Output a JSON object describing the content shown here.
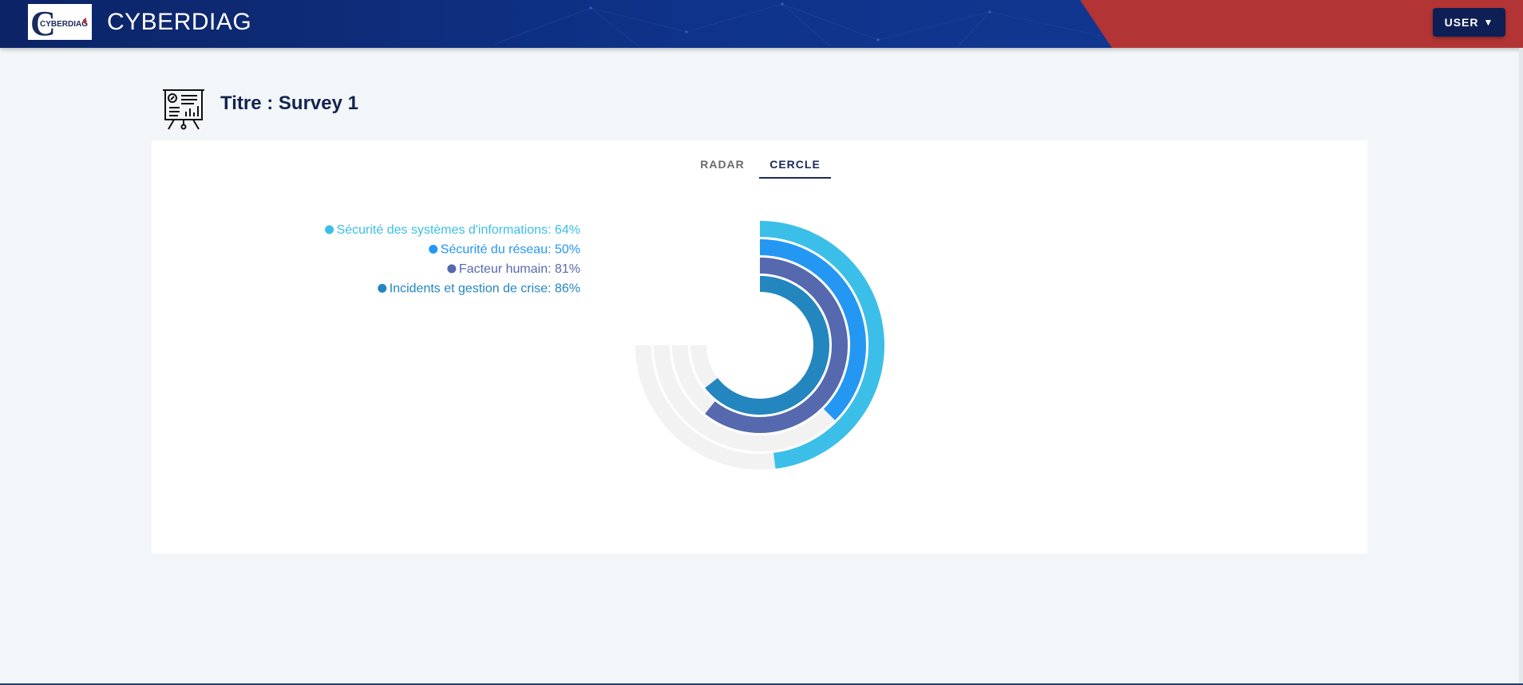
{
  "header": {
    "logo_text": "CYBERDIAG",
    "app_title": "CYBERDIAG",
    "user_button_label": "USER",
    "user_button_caret": "▼"
  },
  "page": {
    "title": "Titre : Survey 1"
  },
  "tabs": [
    {
      "label": "RADAR",
      "active": false
    },
    {
      "label": "CERCLE",
      "active": true
    }
  ],
  "colors": {
    "header_blue": "#0f338a",
    "header_red": "#b23434",
    "title_navy": "#13244f",
    "track": "#f2f2f2"
  },
  "chart_data": {
    "type": "radialBar",
    "series": [
      {
        "name": "Sécurité des systèmes d'informations",
        "value": 64,
        "color": "#3bbfe8",
        "label": "Sécurité des systèmes d'informations: 64%"
      },
      {
        "name": "Sécurité du réseau",
        "value": 50,
        "color": "#2497f3",
        "label": "Sécurité du réseau: 50%"
      },
      {
        "name": "Facteur humain",
        "value": 81,
        "color": "#5669af",
        "label": "Facteur humain: 81%"
      },
      {
        "name": "Incidents et gestion de crise",
        "value": 86,
        "color": "#2486bf",
        "label": "Incidents et gestion de crise: 86%"
      }
    ],
    "max": 100,
    "start_angle_deg": 0,
    "end_angle_deg": 270,
    "legend_position": "top-left"
  }
}
